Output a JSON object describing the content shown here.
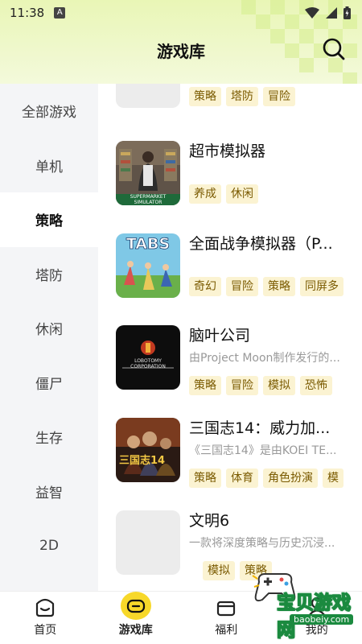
{
  "status": {
    "time": "11:38",
    "notif_letter": "A"
  },
  "header": {
    "title": "游戏库"
  },
  "sidebar": {
    "items": [
      {
        "label": "全部游戏"
      },
      {
        "label": "单机"
      },
      {
        "label": "策略",
        "active": true
      },
      {
        "label": "塔防"
      },
      {
        "label": "休闲"
      },
      {
        "label": "僵尸"
      },
      {
        "label": "生存"
      },
      {
        "label": "益智"
      },
      {
        "label": "2D"
      }
    ]
  },
  "games": [
    {
      "title": "",
      "desc": "",
      "tags": [
        "策略",
        "塔防",
        "冒险"
      ]
    },
    {
      "title": "超市模拟器",
      "desc": "",
      "tags": [
        "养成",
        "休闲"
      ],
      "thumb_caption": "SUPERMARKET SIMULATOR"
    },
    {
      "title": "全面战争模拟器（P...",
      "desc": "",
      "tags": [
        "奇幻",
        "冒险",
        "策略",
        "同屏多"
      ],
      "thumb_caption": "TABS"
    },
    {
      "title": "脑叶公司",
      "desc": "由Project Moon制作发行的...",
      "tags": [
        "策略",
        "冒险",
        "模拟",
        "恐怖"
      ],
      "thumb_caption": "LOBOTOMY CORPORATION"
    },
    {
      "title": "三国志14：威力加...",
      "desc": "《三国志14》是由KOEI TE...",
      "tags": [
        "策略",
        "体育",
        "角色扮演",
        "模"
      ],
      "thumb_caption": "三国志14"
    },
    {
      "title": "文明6",
      "desc": "一款将深度策略与历史沉浸...",
      "tags": [
        "模拟",
        "策略"
      ]
    }
  ],
  "bottom_nav": [
    {
      "label": "首页",
      "icon": "home-icon"
    },
    {
      "label": "游戏库",
      "icon": "gamepad-icon",
      "active": true
    },
    {
      "label": "福利",
      "icon": "gift-icon"
    },
    {
      "label": "我的",
      "icon": "profile-icon"
    }
  ],
  "watermark": {
    "text": "宝贝游戏网",
    "url": "baobeiy.com"
  },
  "colors": {
    "accent": "#f7d82a",
    "tag_bg": "#fbf3d2",
    "tag_text": "#7a5a00",
    "sidebar_bg": "#f4f5f7"
  }
}
